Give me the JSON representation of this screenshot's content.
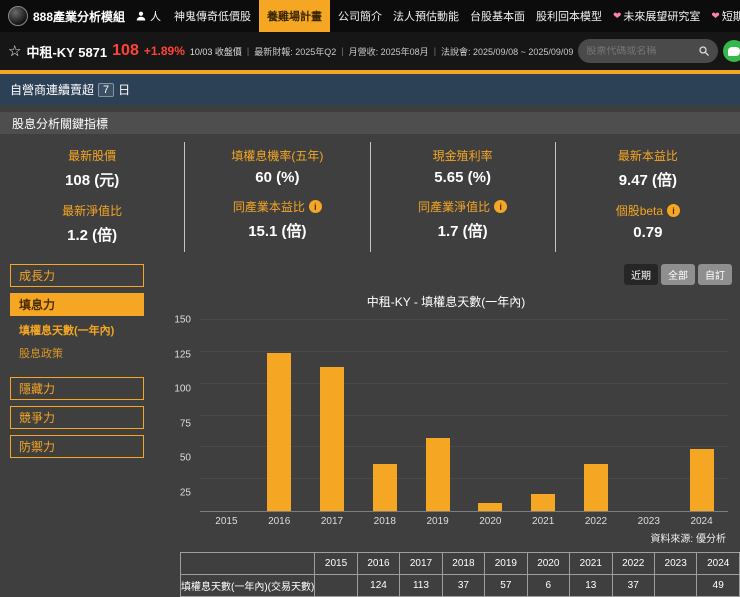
{
  "accent_color": "#f5a623",
  "up_color": "#ff4437",
  "topnav": {
    "brand": "888產業分析模組",
    "person_label": "人",
    "items": [
      {
        "label": "神鬼傳奇低價股",
        "active": false,
        "heart": false
      },
      {
        "label": "養雞場計畫",
        "active": true,
        "heart": false
      },
      {
        "label": "公司簡介",
        "active": false,
        "heart": false
      },
      {
        "label": "法人預估動能",
        "active": false,
        "heart": false
      },
      {
        "label": "台股基本面",
        "active": false,
        "heart": false
      },
      {
        "label": "股利回本模型",
        "active": false,
        "heart": false
      },
      {
        "label": "未來展望研究室",
        "active": false,
        "heart": true
      },
      {
        "label": "短期動能研究室",
        "active": false,
        "heart": true
      }
    ]
  },
  "stockbar": {
    "name": "中租-KY 5871",
    "price": "108",
    "change": "+1.89%",
    "price_note": "10/03 收盤價",
    "info": [
      "最新財報: 2025年Q2",
      "月營收: 2025年08月",
      "法說會: 2025/09/08 ~ 2025/09/09"
    ],
    "search_placeholder": "股票代碼或名稱"
  },
  "ticker": {
    "label": "自營商連續賣超",
    "value": "7",
    "unit": "日"
  },
  "section_title": "股息分析關鍵指標",
  "metrics": {
    "columns": [
      {
        "top": {
          "label": "最新股價",
          "value": "108 (元)",
          "info": false
        },
        "bottom": {
          "label": "最新淨值比",
          "value": "1.2 (倍)",
          "info": false
        }
      },
      {
        "top": {
          "label": "填權息機率(五年)",
          "value": "60 (%)",
          "info": false
        },
        "bottom": {
          "label": "同產業本益比",
          "value": "15.1 (倍)",
          "info": true
        }
      },
      {
        "top": {
          "label": "現金殖利率",
          "value": "5.65 (%)",
          "info": false
        },
        "bottom": {
          "label": "同產業淨值比",
          "value": "1.7 (倍)",
          "info": true
        }
      },
      {
        "top": {
          "label": "最新本益比",
          "value": "9.47 (倍)",
          "info": false
        },
        "bottom": {
          "label": "個股beta",
          "value": "0.79",
          "info": true
        }
      }
    ]
  },
  "sidebar": {
    "items": [
      {
        "label": "成長力",
        "type": "box",
        "active": false
      },
      {
        "label": "填息力",
        "type": "box",
        "active": true
      },
      {
        "label": "填權息天數(一年內)",
        "type": "sub",
        "selected": true
      },
      {
        "label": "股息政策",
        "type": "sub",
        "selected": false
      },
      {
        "label": "隱藏力",
        "type": "box",
        "active": false
      },
      {
        "label": "競爭力",
        "type": "box",
        "active": false
      },
      {
        "label": "防禦力",
        "type": "box",
        "active": false
      }
    ]
  },
  "chart": {
    "ranges": [
      {
        "label": "近期",
        "active": true
      },
      {
        "label": "全部",
        "active": false
      },
      {
        "label": "自訂",
        "active": false
      }
    ],
    "title": "中租-KY - 填權息天數(一年內)",
    "source": "資料來源: 優分析"
  },
  "chart_data": {
    "type": "bar",
    "title": "中租-KY - 填權息天數(一年內)",
    "series_name": "填權息天數(一年內)(交易天數)",
    "categories": [
      "2015",
      "2016",
      "2017",
      "2018",
      "2019",
      "2020",
      "2021",
      "2022",
      "2023",
      "2024"
    ],
    "values": [
      null,
      124,
      113,
      37,
      57,
      6,
      13,
      37,
      null,
      49
    ],
    "ylim": [
      0,
      150
    ],
    "yticks": [
      150,
      125,
      100,
      75,
      50,
      25
    ],
    "bar_color": "#f5a623",
    "grid": true,
    "legend": false,
    "xlabel": "",
    "ylabel": ""
  },
  "table": {
    "header": [
      "",
      "2015",
      "2016",
      "2017",
      "2018",
      "2019",
      "2020",
      "2021",
      "2022",
      "2023",
      "2024"
    ],
    "rows": [
      {
        "label": "填權息天數(一年內)(交易天數)",
        "values": [
          "",
          "124",
          "113",
          "37",
          "57",
          "6",
          "13",
          "37",
          "",
          "49"
        ]
      }
    ]
  }
}
